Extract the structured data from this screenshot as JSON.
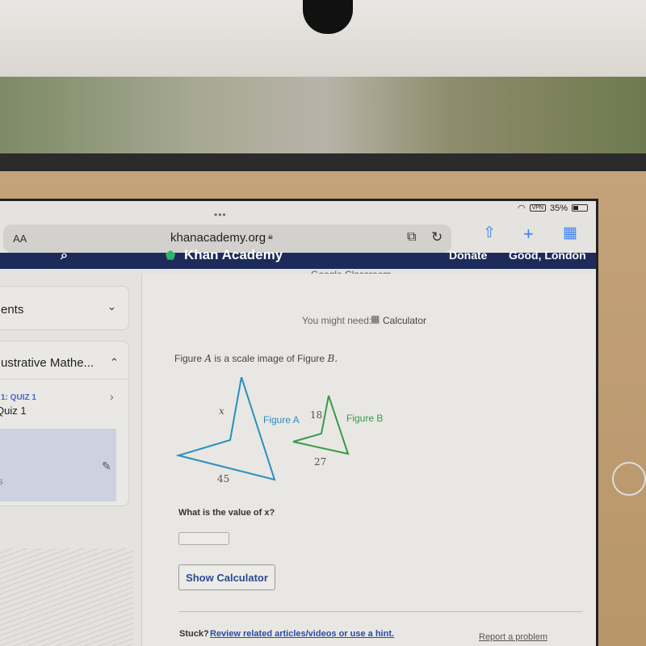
{
  "status": {
    "vpn": "VPN",
    "battery": "35%"
  },
  "browser": {
    "text_size": "AA",
    "url": "khanacademy.org"
  },
  "header": {
    "logo": "Khan Academy",
    "donate": "Donate",
    "greeting": "Good, London",
    "classroom": "Google Classroom"
  },
  "sidebar": {
    "section1": "ents",
    "section2": "ustrative Mathe...",
    "quiz_label": "1: QUIZ 1",
    "quiz_title": "Quiz 1",
    "item": "gs"
  },
  "main": {
    "might_need": "You might need:",
    "calculator": "Calculator",
    "prompt_pre": "Figure",
    "prompt_a": "A",
    "prompt_mid": "is a scale image of Figure",
    "prompt_b": "B.",
    "figure_a": {
      "label": "Figure A",
      "side_x": "x",
      "side_bottom": "45",
      "color": "#2a8fbd"
    },
    "figure_b": {
      "label": "Figure B",
      "side_left": "18",
      "side_bottom": "27",
      "color": "#3a9a48"
    },
    "question": "What is the value of x?",
    "answer": "",
    "show_calc": "Show Calculator",
    "stuck": "Stuck?",
    "hint_link": "Review related articles/videos or use a hint.",
    "report": "Report a problem"
  }
}
